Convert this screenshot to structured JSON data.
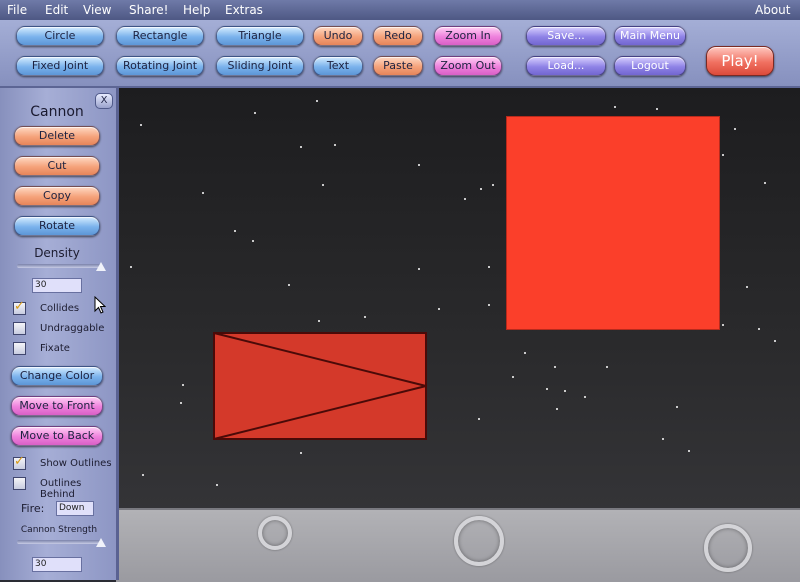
{
  "menu": {
    "file": "File",
    "edit": "Edit",
    "view": "View",
    "share": "Share!",
    "help": "Help",
    "extras": "Extras",
    "about": "About"
  },
  "toolbar": {
    "circle": "Circle",
    "rectangle": "Rectangle",
    "triangle": "Triangle",
    "undo": "Undo",
    "redo": "Redo",
    "zoom_in": "Zoom In",
    "save": "Save...",
    "main_menu": "Main Menu",
    "fixed_joint": "Fixed Joint",
    "rotating_joint": "Rotating Joint",
    "sliding_joint": "Sliding Joint",
    "text": "Text",
    "paste": "Paste",
    "zoom_out": "Zoom Out",
    "load": "Load...",
    "logout": "Logout",
    "play": "Play!"
  },
  "panel": {
    "title": "Cannon",
    "close": "X",
    "delete": "Delete",
    "cut": "Cut",
    "copy": "Copy",
    "rotate": "Rotate",
    "density_label": "Density",
    "density_value": "30",
    "collides": "Collides",
    "undraggable": "Undraggable",
    "fixate": "Fixate",
    "change_color": "Change Color",
    "move_front": "Move to Front",
    "move_back": "Move to Back",
    "show_outlines": "Show Outlines",
    "outlines_behind": "Outlines Behind",
    "fire_label": "Fire:",
    "fire_value": "Down",
    "strength_label": "Cannon Strength",
    "strength_value": "30"
  },
  "checkboxes": {
    "collides": true,
    "undraggable": false,
    "fixate": false,
    "show_outlines": true,
    "outlines_behind": false
  },
  "sliders": {
    "density_fraction": 1.0,
    "strength_fraction": 1.0
  },
  "colors": {
    "square": "#fb3f2a",
    "cannon": "#d4392a",
    "outline": "#4a0a08"
  }
}
